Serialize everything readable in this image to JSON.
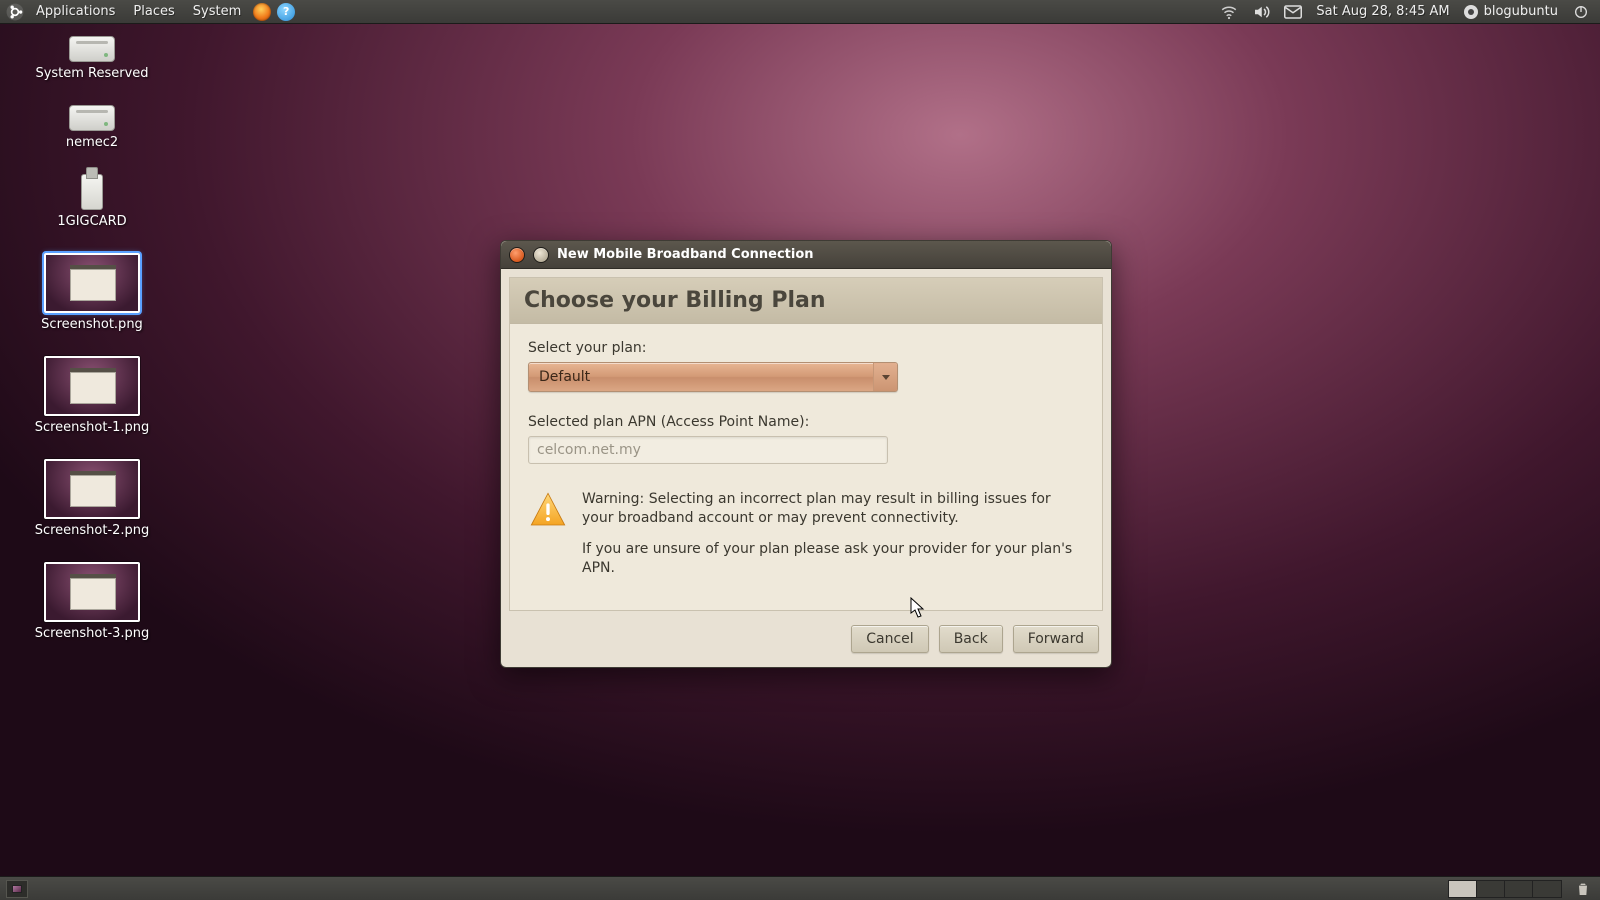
{
  "panel": {
    "menus": {
      "applications": "Applications",
      "places": "Places",
      "system": "System"
    },
    "clock": "Sat Aug 28,  8:45 AM",
    "username": "blogubuntu"
  },
  "desktop": {
    "icons": [
      {
        "type": "drive",
        "label": "System Reserved"
      },
      {
        "type": "drive",
        "label": "nemec2"
      },
      {
        "type": "usb",
        "label": "1GIGCARD"
      },
      {
        "type": "thumb",
        "label": "Screenshot.png",
        "selected": true
      },
      {
        "type": "thumb",
        "label": "Screenshot-1.png"
      },
      {
        "type": "thumb",
        "label": "Screenshot-2.png"
      },
      {
        "type": "thumb",
        "label": "Screenshot-3.png"
      }
    ]
  },
  "dialog": {
    "title": "New Mobile Broadband Connection",
    "header": "Choose your Billing Plan",
    "select_label": "Select your plan:",
    "plan_value": "Default",
    "apn_label": "Selected plan APN (Access Point Name):",
    "apn_value": "celcom.net.my",
    "warning_line1": "Warning: Selecting an incorrect plan may result in billing issues for your broadband account or may prevent connectivity.",
    "warning_line2": "If you are unsure of your plan please ask your provider for your plan's APN.",
    "buttons": {
      "cancel": "Cancel",
      "back": "Back",
      "forward": "Forward"
    }
  }
}
